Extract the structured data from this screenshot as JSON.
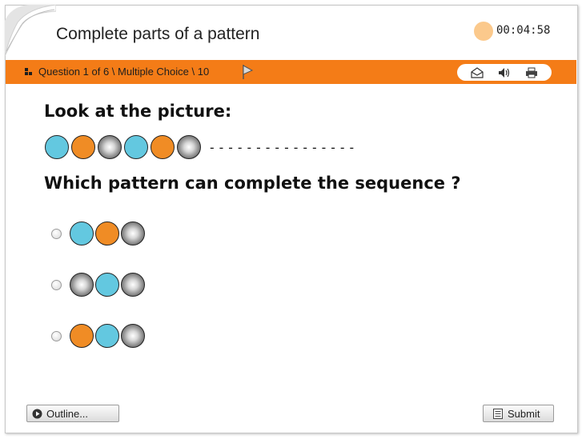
{
  "header": {
    "title": "Complete parts of a pattern",
    "timer": "00:04:58"
  },
  "bar": {
    "question_info": "Question 1 of 6 \\ Multiple Choice \\ 10"
  },
  "toolbar": {
    "icons": [
      "email-icon",
      "speaker-icon",
      "print-icon"
    ],
    "flag_icon": "flag-icon"
  },
  "question": {
    "prompt1": "Look at the picture:",
    "sequence": [
      "blue",
      "orange",
      "grey",
      "blue",
      "orange",
      "grey"
    ],
    "dashes": "----------------",
    "prompt2": "Which pattern can complete the sequence ?"
  },
  "options": [
    {
      "balls": [
        "blue",
        "orange",
        "grey"
      ],
      "selected": false
    },
    {
      "balls": [
        "grey",
        "blue",
        "grey"
      ],
      "selected": false
    },
    {
      "balls": [
        "orange",
        "blue",
        "grey"
      ],
      "selected": false
    }
  ],
  "footer": {
    "outline_label": "Outline...",
    "submit_label": "Submit"
  },
  "colors": {
    "accent": "#f47c17",
    "blue_ball": "#63c8e0",
    "orange_ball": "#f08c25",
    "timer_dot": "#fbc98c"
  }
}
